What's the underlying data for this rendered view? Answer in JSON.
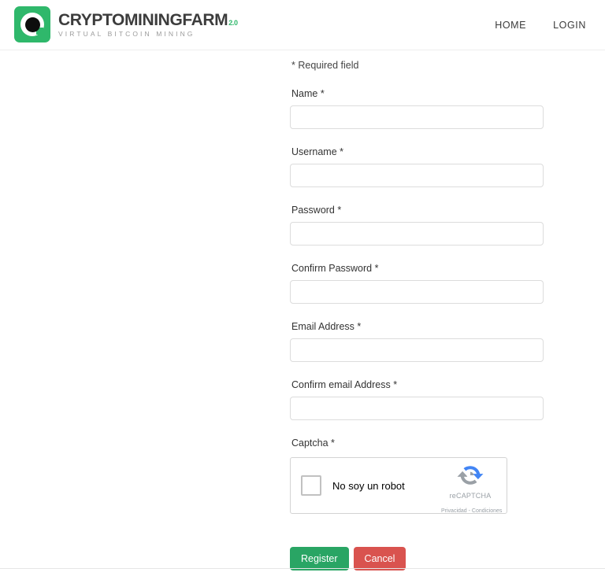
{
  "header": {
    "brand": {
      "name": "CRYPTOMININGFARM",
      "version": "2.0",
      "tagline": "VIRTUAL BITCOIN MINING",
      "mark_color": "#2fb86b",
      "version_color": "#2fb86b"
    },
    "nav": [
      {
        "label": "HOME"
      },
      {
        "label": "LOGIN"
      }
    ]
  },
  "form": {
    "required_note": "* Required field",
    "fields": [
      {
        "label": "Name *",
        "value": "",
        "placeholder": "",
        "type": "text",
        "name": "name"
      },
      {
        "label": "Username *",
        "value": "",
        "placeholder": "",
        "type": "text",
        "name": "username"
      },
      {
        "label": "Password *",
        "value": "",
        "placeholder": "",
        "type": "password",
        "name": "password"
      },
      {
        "label": "Confirm Password *",
        "value": "",
        "placeholder": "",
        "type": "password",
        "name": "confirm-password"
      },
      {
        "label": "Email Address *",
        "value": "",
        "placeholder": "",
        "type": "text",
        "name": "email"
      },
      {
        "label": "Confirm email Address *",
        "value": "",
        "placeholder": "",
        "type": "text",
        "name": "confirm-email"
      }
    ],
    "captcha": {
      "label": "Captcha *",
      "checkbox_label": "No soy un robot",
      "brand": "reCAPTCHA",
      "legal": "Privacidad - Condiciones",
      "checked": false
    },
    "buttons": {
      "register": {
        "label": "Register",
        "color": "#29a564"
      },
      "cancel": {
        "label": "Cancel",
        "color": "#d9534f"
      }
    }
  }
}
